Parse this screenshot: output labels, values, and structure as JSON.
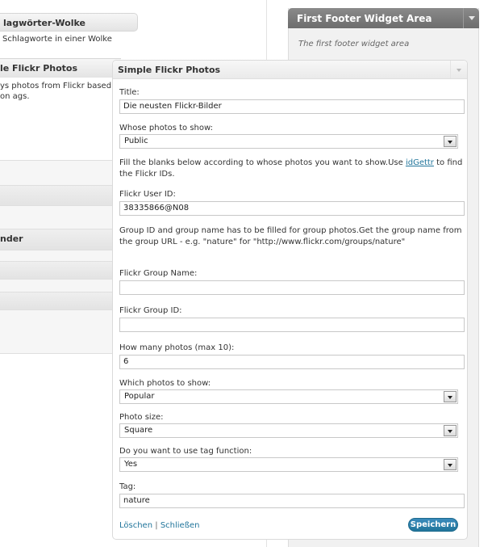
{
  "left": {
    "tagcloud_title": "lagwörter-Wolke",
    "tagcloud_desc": "Schlagworte in einer Wolke",
    "flickr_title": "le Flickr Photos",
    "flickr_desc": "ys photos from Flickr based on ags.",
    "calendar_title": "nder"
  },
  "footer_area": {
    "title": "First Footer Widget Area",
    "description": "The first footer widget area"
  },
  "widget": {
    "title": "Simple Flickr Photos",
    "title_label": "Title:",
    "title_value": "Die neusten Flickr-Bilder",
    "whose_label": "Whose photos to show:",
    "whose_value": "Public",
    "help1_pre": "Fill the blanks below according to whose photos you want to show.Use ",
    "help1_link": "idGettr",
    "help1_post": " to find the Flickr IDs.",
    "userid_label": "Flickr User ID:",
    "userid_value": "38335866@N08",
    "help2": "Group ID and group name has to be filled for group photos.Get the group name from the group URL - e.g. \"nature\" for \"http://www.flickr.com/groups/nature\"",
    "groupname_label": "Flickr Group Name:",
    "groupname_value": "",
    "groupid_label": "Flickr Group ID:",
    "groupid_value": "",
    "howmany_label": "How many photos (max 10):",
    "howmany_value": "6",
    "which_label": "Which photos to show:",
    "which_value": "Popular",
    "size_label": "Photo size:",
    "size_value": "Square",
    "tagfn_label": "Do you want to use tag function:",
    "tagfn_value": "Yes",
    "tag_label": "Tag:",
    "tag_value": "nature",
    "delete_label": "Löschen",
    "separator": "|",
    "close_label": "Schließen",
    "save_label": "Speichern"
  }
}
